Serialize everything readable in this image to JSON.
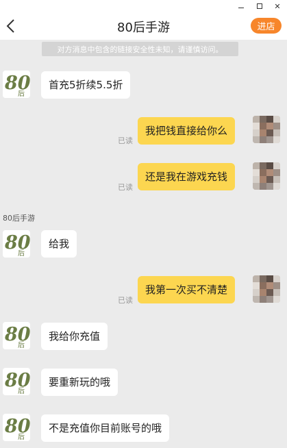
{
  "window": {
    "minimize_icon": "minimize-icon",
    "maximize_icon": "maximize-icon",
    "close_icon": "close-icon",
    "close_glyph": "✕"
  },
  "header": {
    "title": "80后手游",
    "back_icon": "chevron-left-icon",
    "enter_label": "进店",
    "accent": "#f7862b"
  },
  "notice": "对方消息中包含的链接安全性未知，请谨慎访问。",
  "sender_name": "80后手游",
  "read_label": "已读",
  "messages": [
    {
      "side": "left",
      "text": "首充5折续5.5折"
    },
    {
      "side": "right",
      "text": "我把钱直接给你么",
      "status": "已读"
    },
    {
      "side": "right",
      "text": "还是我在游戏充钱",
      "status": "已读"
    },
    {
      "side": "left",
      "text": "给我"
    },
    {
      "side": "right",
      "text": "我第一次买不清楚",
      "status": "已读"
    },
    {
      "side": "left",
      "text": "我给你充值"
    },
    {
      "side": "left",
      "text": "要重新玩的哦"
    },
    {
      "side": "left",
      "text": "不是充值你目前账号的哦"
    }
  ],
  "avatars": {
    "shop_logo_text": "80后",
    "shop_logo_color": "#6b7d45",
    "user_avatar": "pixelated-user-avatar"
  },
  "colors": {
    "background": "#ebebeb",
    "bubble_self": "#fcd650",
    "bubble_other": "#ffffff"
  }
}
